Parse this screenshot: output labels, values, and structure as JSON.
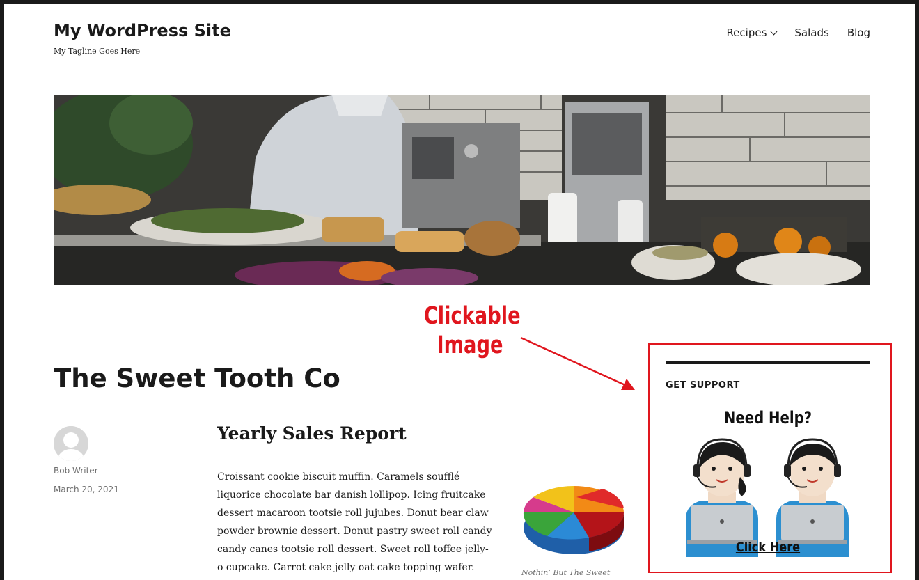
{
  "site": {
    "title": "My WordPress Site",
    "tagline": "My Tagline Goes Here"
  },
  "nav": {
    "items": [
      {
        "label": "Recipes",
        "has_submenu": true
      },
      {
        "label": "Salads",
        "has_submenu": false
      },
      {
        "label": "Blog",
        "has_submenu": false
      }
    ]
  },
  "annotation": {
    "line1": "Clickable",
    "line2": "Image",
    "color": "#e0161e"
  },
  "page": {
    "title": "The Sweet Tooth Co"
  },
  "post": {
    "author": "Bob Writer",
    "date": "March 20, 2021",
    "title": "Yearly Sales Report",
    "body_lines": [
      "Croissant cookie biscuit muffin. Caramels soufflé",
      "liquorice chocolate bar danish lollipop. Icing fruitcake",
      "dessert macaroon tootsie roll jujubes. Donut bear claw",
      "powder brownie dessert. Donut pastry sweet roll candy",
      "candy canes tootsie roll dessert. Sweet roll toffee jelly-",
      "o cupcake. Carrot cake jelly oat cake topping wafer."
    ],
    "image_caption": "Nothin’ But The Sweet"
  },
  "sidebar": {
    "widget_title": "GET SUPPORT",
    "image_heading": "Need Help?",
    "image_cta": "Click Here"
  },
  "icons": [
    "chevron-down-icon",
    "avatar-icon",
    "pie-chart-image",
    "support-agents-image"
  ]
}
